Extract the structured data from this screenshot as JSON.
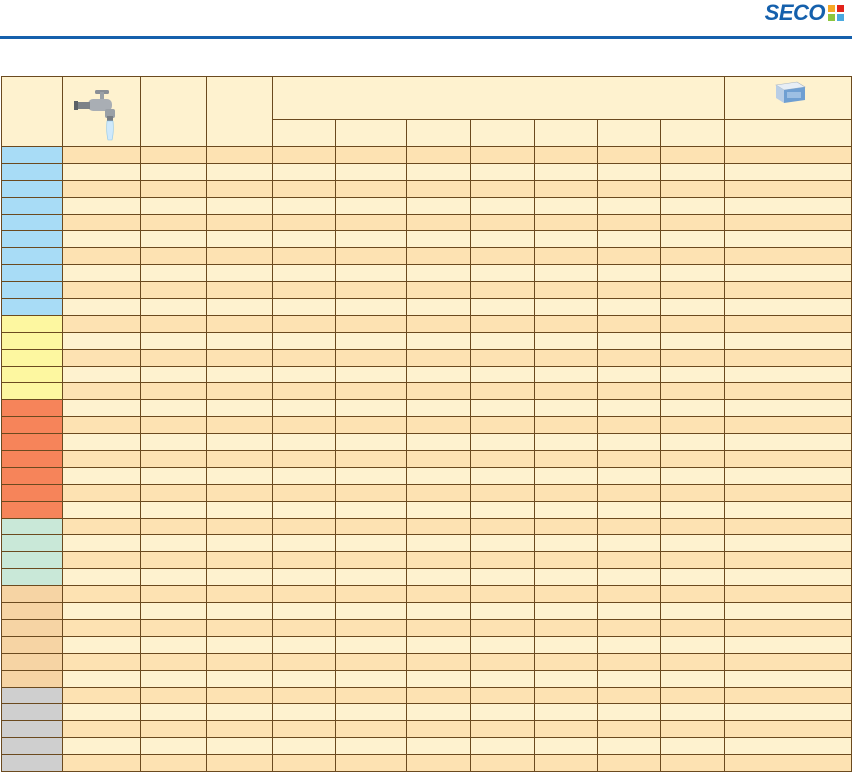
{
  "brand": {
    "logo_text": "SECO"
  },
  "colors": {
    "brand_blue": "#1560ac",
    "row_odd": "#fde2b2",
    "row_even": "#fef2cf",
    "header_fill": "#fef2cf",
    "grid_line": "#6b4a1f"
  },
  "header_icons": [
    "water-tap-icon",
    "workpiece-block-icon"
  ],
  "groups": [
    {
      "color": "#a8dcf6",
      "rows": 10
    },
    {
      "color": "#fdf7a0",
      "rows": 5
    },
    {
      "color": "#f6845a",
      "rows": 7
    },
    {
      "color": "#c9e8d8",
      "rows": 4
    },
    {
      "color": "#f6d4a4",
      "rows": 6
    },
    {
      "color": "#cfcfcf",
      "rows": 5
    }
  ],
  "column_count": 12,
  "sub_column_count": 8
}
